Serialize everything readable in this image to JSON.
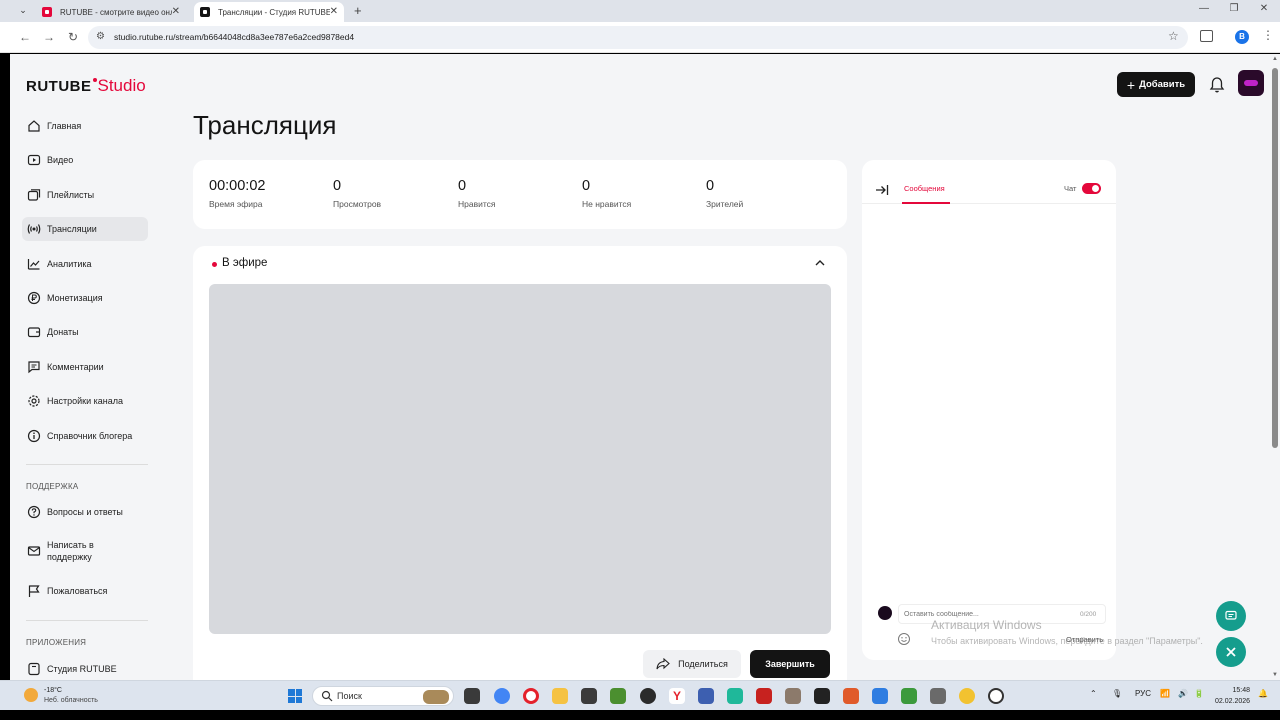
{
  "browser": {
    "tabs": [
      {
        "title": "RUTUBE - смотрите видео онлайн",
        "active": false
      },
      {
        "title": "Трансляции - Студия RUTUBE",
        "active": true
      }
    ],
    "url": "studio.rutube.ru/stream/b6644048cd8a3ee787e6a2ced9878ed4",
    "profile_initial": "B"
  },
  "header": {
    "logo_main": "RUTUBE",
    "logo_studio": "Studio",
    "add_button": "Добавить"
  },
  "sidebar": {
    "items": [
      {
        "label": "Главная",
        "icon": "home-icon",
        "active": false
      },
      {
        "label": "Видео",
        "icon": "video-icon",
        "active": false
      },
      {
        "label": "Плейлисты",
        "icon": "playlist-icon",
        "active": false
      },
      {
        "label": "Трансляции",
        "icon": "broadcast-icon",
        "active": true
      },
      {
        "label": "Аналитика",
        "icon": "analytics-icon",
        "active": false
      },
      {
        "label": "Монетизация",
        "icon": "ruble-icon",
        "active": false
      },
      {
        "label": "Донаты",
        "icon": "donate-icon",
        "active": false
      },
      {
        "label": "Комментарии",
        "icon": "comment-icon",
        "active": false
      },
      {
        "label": "Настройки канала",
        "icon": "gear-icon",
        "active": false
      },
      {
        "label": "Справочник блогера",
        "icon": "info-icon",
        "active": false
      }
    ],
    "support_heading": "ПОДДЕРЖКА",
    "support_items": [
      {
        "label": "Вопросы и ответы",
        "icon": "question-icon"
      },
      {
        "label": "Написать в поддержку",
        "icon": "mail-icon"
      },
      {
        "label": "Пожаловаться",
        "icon": "flag-icon"
      }
    ],
    "apps_heading": "ПРИЛОЖЕНИЯ",
    "apps_items": [
      {
        "label": "Студия RUTUBE",
        "icon": "app-icon"
      }
    ]
  },
  "main": {
    "title": "Трансляция",
    "stats": [
      {
        "value": "00:00:02",
        "label": "Время эфира"
      },
      {
        "value": "0",
        "label": "Просмотров"
      },
      {
        "value": "0",
        "label": "Нравится"
      },
      {
        "value": "0",
        "label": "Не нравится"
      },
      {
        "value": "0",
        "label": "Зрителей"
      }
    ],
    "live_label": "В эфире",
    "share_button": "Поделиться",
    "end_button": "Завершить"
  },
  "chat": {
    "tab_messages": "Сообщения",
    "chat_label": "Чат",
    "chat_enabled": true,
    "input_placeholder": "Оставить сообщение...",
    "counter": "0/200",
    "send_button": "Отправить"
  },
  "watermark": {
    "title": "Активация Windows",
    "subtitle": "Чтобы активировать Windows, перейдите в раздел \"Параметры\"."
  },
  "taskbar": {
    "weather_temp": "-18°C",
    "weather_desc": "Неб. облачность",
    "search_placeholder": "Поиск",
    "language": "РУС",
    "time": "15:48",
    "date": "02.02.2026"
  }
}
